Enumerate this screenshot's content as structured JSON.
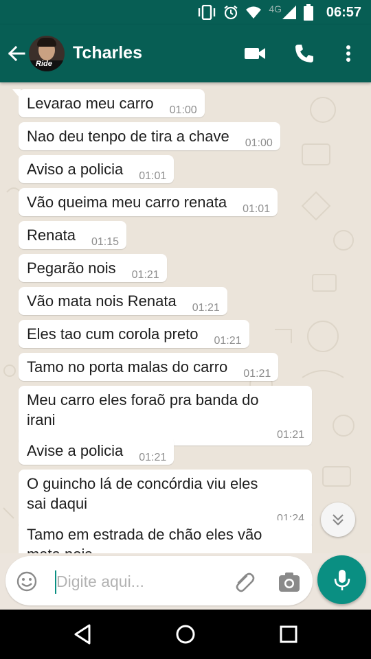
{
  "status_bar": {
    "time": "06:57",
    "network": "4G"
  },
  "contact": {
    "name": "Tcharles",
    "avatar_caption": "Ride"
  },
  "messages": [
    {
      "text": "Levarao meu carro",
      "time": "01:00"
    },
    {
      "text": "Nao deu tenpo de tira a chave",
      "time": "01:00"
    },
    {
      "text": "Aviso a policia",
      "time": "01:01"
    },
    {
      "text": "Vão queima meu carro renata",
      "time": "01:01"
    },
    {
      "text": "Renata",
      "time": "01:15"
    },
    {
      "text": "Pegarão nois",
      "time": "01:21"
    },
    {
      "text": "Vão mata nois Renata",
      "time": "01:21"
    },
    {
      "text": "Eles tao cum corola preto",
      "time": "01:21"
    },
    {
      "text": "Tamo no porta malas do carro",
      "time": "01:21"
    },
    {
      "text": "Meu carro eles foraõ pra banda do irani",
      "time": "01:21"
    },
    {
      "text": "Avise a policia",
      "time": "01:21"
    },
    {
      "text": "O guincho lá de concórdia viu eles sai daqui",
      "time": "01:24"
    },
    {
      "text": "Tamo em estrada de chão eles vão mata nois",
      "time": ""
    }
  ],
  "composer": {
    "placeholder": "Digite aqui...",
    "value": ""
  },
  "colors": {
    "header": "#075e54",
    "accent": "#0a8f82",
    "chat_bg": "#ece5dd",
    "bubble": "#ffffff"
  },
  "icons": {
    "back": "arrow-left-icon",
    "video": "video-camera-icon",
    "call": "phone-icon",
    "menu": "more-vertical-icon",
    "emoji": "emoji-icon",
    "attach": "paperclip-icon",
    "camera": "camera-icon",
    "mic": "microphone-icon",
    "scroll": "chevron-double-down-icon",
    "nav": [
      "triangle-back-icon",
      "circle-home-icon",
      "square-recents-icon"
    ]
  }
}
